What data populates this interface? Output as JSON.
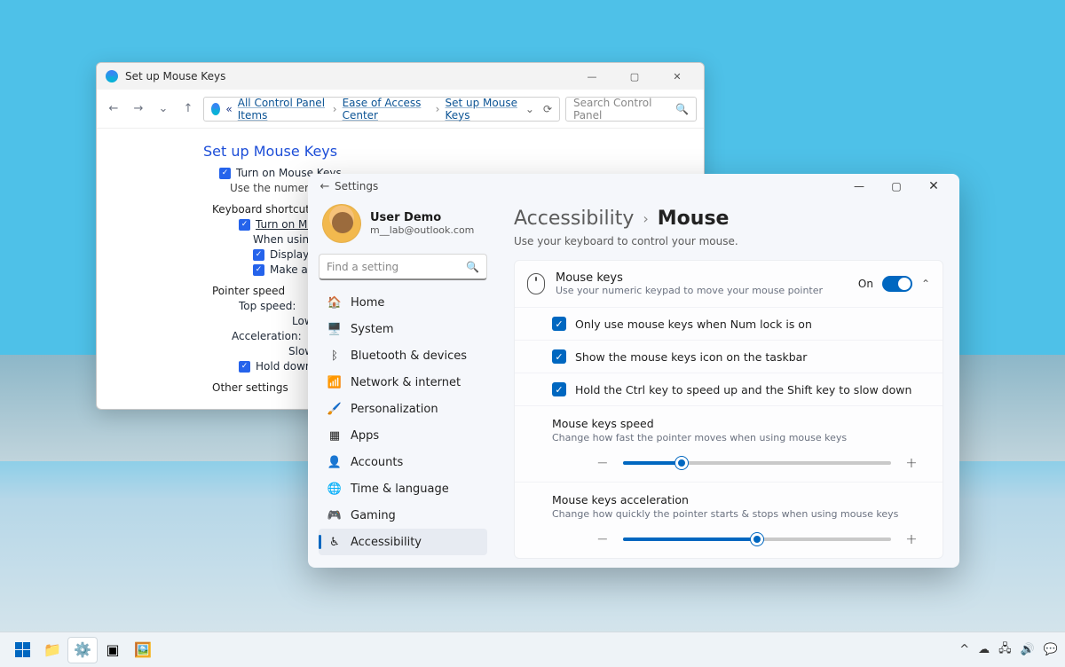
{
  "control_panel": {
    "title": "Set up Mouse Keys",
    "breadcrumb": {
      "root": "«",
      "b1": "All Control Panel Items",
      "b2": "Ease of Access Center",
      "b3": "Set up Mouse Keys"
    },
    "search_placeholder": "Search Control Panel",
    "heading": "Set up Mouse Keys",
    "turn_on": "Turn on Mouse Keys",
    "turn_on_desc": "Use the numeric keypad to move the mouse around the screen",
    "section_shortcut": "Keyboard shortcut",
    "opt_shortcut": "Turn on Mouse Keys",
    "when_using": "When using keyboa",
    "opt_warn": "Display a warnin",
    "opt_sound": "Make a sound w",
    "section_speed": "Pointer speed",
    "top_speed": "Top speed:",
    "low": "Low",
    "accel": "Acceleration:",
    "slow": "Slow",
    "hold_ctrl": "Hold down CTRL to s",
    "other": "Other settings"
  },
  "settings": {
    "title": "Settings",
    "user": {
      "name": "User Demo",
      "email": "m__lab@outlook.com"
    },
    "search_placeholder": "Find a setting",
    "nav": [
      {
        "label": "Home",
        "icon": "🏠"
      },
      {
        "label": "System",
        "icon": "🖥️"
      },
      {
        "label": "Bluetooth & devices",
        "icon": "ᛒ"
      },
      {
        "label": "Network & internet",
        "icon": "📶"
      },
      {
        "label": "Personalization",
        "icon": "🖌️"
      },
      {
        "label": "Apps",
        "icon": "▦"
      },
      {
        "label": "Accounts",
        "icon": "👤"
      },
      {
        "label": "Time & language",
        "icon": "🌐"
      },
      {
        "label": "Gaming",
        "icon": "🎮"
      },
      {
        "label": "Accessibility",
        "icon": "♿"
      }
    ],
    "breadcrumb": {
      "parent": "Accessibility",
      "current": "Mouse"
    },
    "page_desc": "Use your keyboard to control your mouse.",
    "mouse_keys": {
      "title": "Mouse keys",
      "desc": "Use your numeric keypad to move your mouse pointer",
      "state": "On",
      "opts": [
        "Only use mouse keys when Num lock is on",
        "Show the mouse keys icon on the taskbar",
        "Hold the Ctrl key to speed up and the Shift key to slow down"
      ],
      "speed": {
        "title": "Mouse keys speed",
        "desc": "Change how fast the pointer moves when using mouse keys",
        "value": 22
      },
      "accel": {
        "title": "Mouse keys acceleration",
        "desc": "Change how quickly the pointer starts & stops when using mouse keys",
        "value": 50
      }
    }
  }
}
